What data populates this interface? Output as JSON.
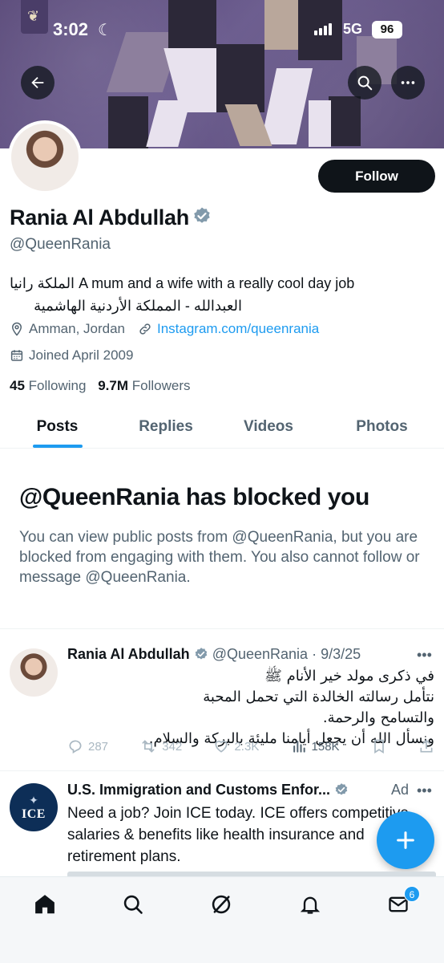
{
  "status_bar": {
    "time": "3:02",
    "network": "5G",
    "battery": "96"
  },
  "profile": {
    "name": "Rania Al Abdullah",
    "handle": "@QueenRania",
    "follow_label": "Follow",
    "bio_line1": "الملكة رانيا A mum and a wife with a really cool day job",
    "bio_line2": "العبدالله - المملكة الأردنية الهاشمية",
    "location": "Amman, Jordan",
    "link": "Instagram.com/queenrania",
    "joined": "Joined April 2009",
    "following_count": "45",
    "following_label": "Following",
    "followers_count": "9.7M",
    "followers_label": "Followers"
  },
  "tabs": [
    {
      "label": "Posts",
      "active": true
    },
    {
      "label": "Replies",
      "active": false
    },
    {
      "label": "Videos",
      "active": false
    },
    {
      "label": "Photos",
      "active": false
    }
  ],
  "blocked": {
    "title": "@QueenRania has blocked you",
    "description": "You can view public posts from @QueenRania, but you are blocked from engaging with them. You also cannot follow or message @QueenRania."
  },
  "post": {
    "author": "Rania Al Abdullah",
    "handle": "@QueenRania",
    "date": "9/3/25",
    "text_line1": "في ذكرى مولد خير الأنام ﷺ",
    "text_line2": "نتأمل رسالته الخالدة التي تحمل المحبة والتسامح والرحمة.",
    "text_line3": "ونسأل الله أن يجعل أيامنا مليئة بالبركة والسلام.",
    "replies": "287",
    "reposts": "342",
    "likes": "2.3K",
    "views": "158K"
  },
  "ad": {
    "author": "U.S. Immigration and Customs Enfor...",
    "label": "Ad",
    "logo_text": "ICE",
    "body": "Need a job? Join ICE today. ICE offers competitive salaries & benefits like health insurance and retirement plans."
  },
  "nav": {
    "messages_badge": "6"
  },
  "colors": {
    "accent": "#1d9bf0",
    "text": "#0f1419",
    "muted": "#536471"
  }
}
